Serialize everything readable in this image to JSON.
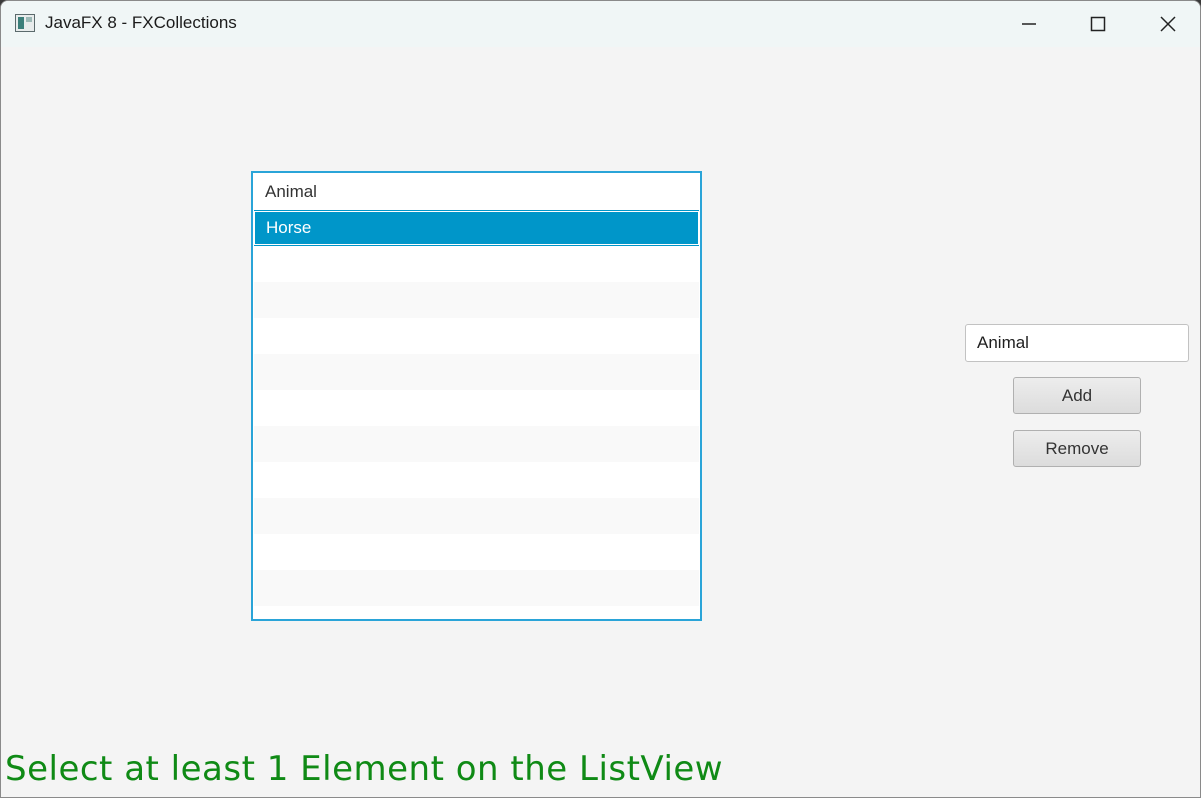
{
  "window": {
    "title": "JavaFX 8 - FXCollections"
  },
  "controls": {
    "minimize_icon": "minimize-icon",
    "maximize_icon": "maximize-icon",
    "close_icon": "close-icon"
  },
  "listview": {
    "items": [
      "Animal",
      "Horse"
    ],
    "selected_index": 1
  },
  "form": {
    "input_value": "Animal",
    "add_label": "Add",
    "remove_label": "Remove"
  },
  "status": {
    "message": "Select at least 1 Element on the ListView"
  },
  "colors": {
    "selection": "#0096c9",
    "list_border": "#2aa4d8",
    "status_text": "#0f8a15"
  }
}
